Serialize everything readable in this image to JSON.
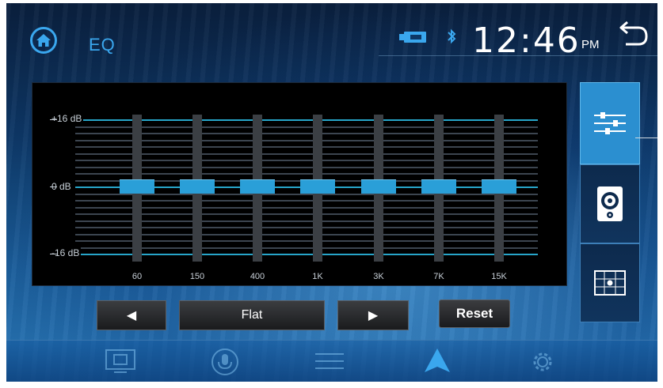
{
  "header": {
    "title": "EQ",
    "time": "12:46",
    "ampm": "PM"
  },
  "equalizer": {
    "db_labels": [
      "+16 dB",
      "0 dB",
      "-16 dB"
    ],
    "bands": [
      {
        "freq": "60",
        "gain_db": 0
      },
      {
        "freq": "150",
        "gain_db": 0
      },
      {
        "freq": "400",
        "gain_db": 0
      },
      {
        "freq": "1K",
        "gain_db": 0
      },
      {
        "freq": "3K",
        "gain_db": 0
      },
      {
        "freq": "7K",
        "gain_db": 0
      },
      {
        "freq": "15K",
        "gain_db": 0
      }
    ]
  },
  "controls": {
    "prev_label": "◀",
    "preset_label": "Flat",
    "next_label": "▶",
    "reset_label": "Reset"
  },
  "side_tabs": [
    "eq-sliders-icon",
    "speaker-icon",
    "balance-fader-icon"
  ],
  "dock": [
    "screen-mirror-icon",
    "voice-mic-icon",
    "sliders-icon",
    "navigation-arrow-icon",
    "settings-gear-icon"
  ],
  "colors": {
    "accent": "#3aa7ee",
    "slider_knob": "#2a9fd8",
    "grid_major": "#27a5c9"
  }
}
